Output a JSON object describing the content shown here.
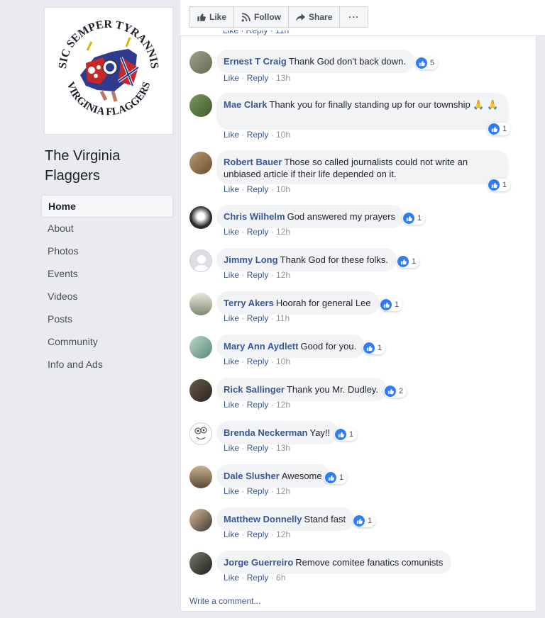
{
  "sidebar": {
    "logo": {
      "top_text": "SIC SEMPER TYRANNIS",
      "bottom_text": "VIRGINIA FLAGGERS"
    },
    "page_name": "The Virginia Flaggers",
    "nav": [
      {
        "label": "Home",
        "active": true
      },
      {
        "label": "About"
      },
      {
        "label": "Photos"
      },
      {
        "label": "Events"
      },
      {
        "label": "Videos"
      },
      {
        "label": "Posts"
      },
      {
        "label": "Community"
      },
      {
        "label": "Info and Ads"
      }
    ]
  },
  "toolbar": {
    "like_label": "Like",
    "follow_label": "Follow",
    "share_label": "Share",
    "more_label": "···"
  },
  "clipped_actions": "Like · Reply · 11h",
  "comments": [
    {
      "author": "Ernest T Craig",
      "text": "Thank God don't back down.",
      "like": "Like",
      "reply": "Reply",
      "time": "13h",
      "reactions": "5"
    },
    {
      "author": "Mae Clark",
      "text": "Thank you for finally standing up for our township 🙏 🙏",
      "like": "Like",
      "reply": "Reply",
      "time": "10h",
      "reactions": "1"
    },
    {
      "author": "Robert Bauer",
      "text": "Those so called journalists could not write an unbiased article if their life depended on it.",
      "like": "Like",
      "reply": "Reply",
      "time": "10h",
      "reactions": "1"
    },
    {
      "author": "Chris Wilhelm",
      "text": "God answered my prayers",
      "like": "Like",
      "reply": "Reply",
      "time": "12h",
      "reactions": "1"
    },
    {
      "author": "Jimmy Long",
      "text": "Thank God for these folks.",
      "like": "Like",
      "reply": "Reply",
      "time": "12h",
      "reactions": "1"
    },
    {
      "author": "Terry Akers",
      "text": "Hoorah for general Lee",
      "like": "Like",
      "reply": "Reply",
      "time": "11h",
      "reactions": "1"
    },
    {
      "author": "Mary Ann Aydlett",
      "text": "Good for you.",
      "like": "Like",
      "reply": "Reply",
      "time": "10h",
      "reactions": "1"
    },
    {
      "author": "Rick Sallinger",
      "text": "Thank you Mr. Dudley.",
      "like": "Like",
      "reply": "Reply",
      "time": "12h",
      "reactions": "2"
    },
    {
      "author": "Brenda Neckerman",
      "text": "Yay!!",
      "like": "Like",
      "reply": "Reply",
      "time": "13h",
      "reactions": "1"
    },
    {
      "author": "Dale Slusher",
      "text": "Awesome",
      "like": "Like",
      "reply": "Reply",
      "time": "12h",
      "reactions": "1"
    },
    {
      "author": "Matthew Donnelly",
      "text": "Stand fast",
      "like": "Like",
      "reply": "Reply",
      "time": "12h",
      "reactions": "1"
    },
    {
      "author": "Jorge Guerreiro",
      "text": "Remove comitee fanatics comunists",
      "like": "Like",
      "reply": "Reply",
      "time": "6h"
    }
  ],
  "write_comment_label": "Write a comment...",
  "colors": {
    "link": "#385898",
    "like_blue": "#2f7df6",
    "bubble": "#f2f3f5",
    "background": "#e9ebee"
  }
}
